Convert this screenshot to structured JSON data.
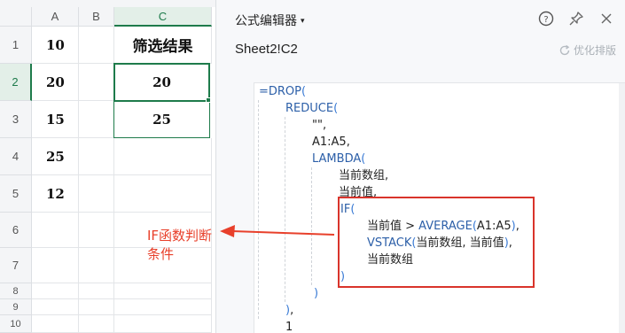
{
  "sheet": {
    "columns": [
      "A",
      "B",
      "C"
    ],
    "rows": [
      "1",
      "2",
      "3",
      "4",
      "5",
      "6",
      "7",
      "8",
      "9",
      "10"
    ],
    "colA": [
      "10",
      "20",
      "15",
      "25",
      "12"
    ],
    "c1": "筛选结果",
    "c2": "20",
    "c3": "25"
  },
  "annotation": {
    "line1": "IF函数判断",
    "line2": "条件"
  },
  "panel": {
    "title": "公式编辑器",
    "cell_ref": "Sheet2!C2",
    "optimize_label": "优化排版"
  },
  "code": {
    "l1_pre": "=DROP",
    "l1_p": "(",
    "l2_fn": "REDUCE",
    "l2_p": "(",
    "l3": "\"\",",
    "l4": "A1:A5,",
    "l5_fn": "LAMBDA",
    "l5_p": "(",
    "l6": "当前数组,",
    "l7": "当前值,",
    "l8_fn": "IF",
    "l8_p": "(",
    "l9_a": "当前值 > ",
    "l9_fn": "AVERAGE",
    "l9_p1": "(",
    "l9_b": "A1:A5",
    "l9_p2": ")",
    "l9_c": ",",
    "l10_fn": "VSTACK",
    "l10_p1": "(",
    "l10_b": "当前数组, 当前值",
    "l10_p2": ")",
    "l10_c": ",",
    "l11": "当前数组",
    "l12": ")",
    "l13": ")",
    "l14_p": ")",
    "l14_c": ",",
    "l15": "1"
  },
  "colors": {
    "accent_green": "#1e7b4b",
    "annotation_red": "#e8402b",
    "function_blue": "#2c5fa8"
  },
  "icons": [
    "chevron-down-icon",
    "help-icon",
    "pin-icon",
    "close-icon",
    "refresh-icon"
  ]
}
